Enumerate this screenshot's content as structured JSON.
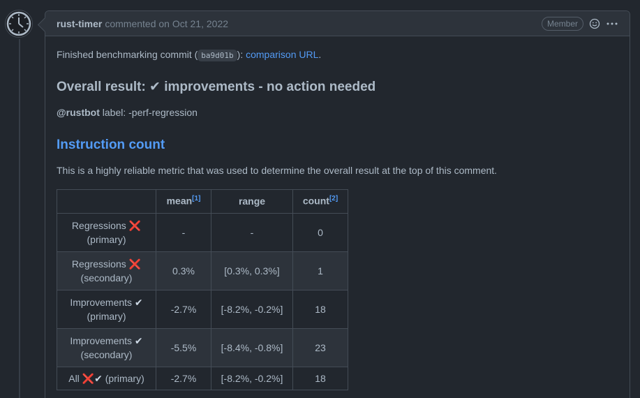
{
  "comment": {
    "author": "rust-timer",
    "action": "commented on Oct 21, 2022",
    "badge": "Member",
    "body": {
      "finished_prefix": "Finished benchmarking commit (",
      "commit_hash": "ba9d01b",
      "finished_mid": "): ",
      "comparison_link": "comparison URL",
      "finished_suffix": ".",
      "overall_result": "Overall result: ✔ improvements - no action needed",
      "mention": "@rustbot",
      "label_text": " label: -perf-regression",
      "section_title": "Instruction count",
      "section_desc": "This is a highly reliable metric that was used to determine the overall result at the top of this comment."
    }
  },
  "table": {
    "headers": {
      "label": "",
      "mean": "mean",
      "mean_note": "[1]",
      "range": "range",
      "count": "count",
      "count_note": "[2]"
    },
    "rows": [
      {
        "line1": "Regressions ",
        "line1_mark": "❌",
        "line2": "(primary)",
        "mean": "-",
        "range": "-",
        "count": "0"
      },
      {
        "line1": "Regressions ",
        "line1_mark": "❌",
        "line2": "(secondary)",
        "mean": "0.3%",
        "range": "[0.3%, 0.3%]",
        "count": "1"
      },
      {
        "line1": "Improvements ",
        "line1_mark": "✔",
        "line2": "(primary)",
        "mean": "-2.7%",
        "range": "[-8.2%, -0.2%]",
        "count": "18"
      },
      {
        "line1": "Improvements ",
        "line1_mark": "✔",
        "line2": "(secondary)",
        "mean": "-5.5%",
        "range": "[-8.4%, -0.8%]",
        "count": "23"
      }
    ],
    "all_row": {
      "prefix": "All ",
      "x_mark": "❌",
      "check_mark": "✔",
      "suffix": " (primary)",
      "mean": "-2.7%",
      "range": "[-8.2%, -0.2%]",
      "count": "18"
    }
  },
  "icons": {
    "avatar": "clock-icon",
    "reaction": "smiley-icon",
    "menu": "kebab-horizontal-icon"
  },
  "colors": {
    "background": "#22272e",
    "header_bg": "#2d333b",
    "border": "#444c56",
    "link": "#539bf5",
    "x_mark": "#f85149"
  }
}
